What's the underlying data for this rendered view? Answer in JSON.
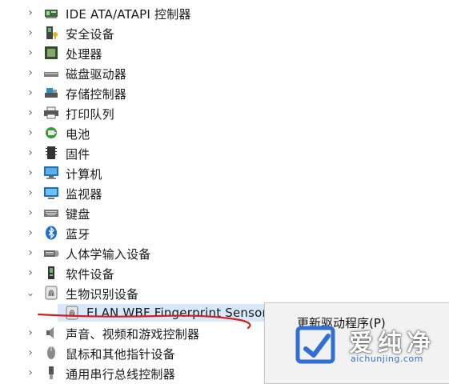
{
  "tree": {
    "items": [
      {
        "label": "IDE ATA/ATAPI 控制器",
        "icon": "ide-controller-icon",
        "expanded": false
      },
      {
        "label": "安全设备",
        "icon": "security-device-icon",
        "expanded": false
      },
      {
        "label": "处理器",
        "icon": "processor-icon",
        "expanded": false
      },
      {
        "label": "磁盘驱动器",
        "icon": "disk-drive-icon",
        "expanded": false
      },
      {
        "label": "存储控制器",
        "icon": "storage-controller-icon",
        "expanded": false
      },
      {
        "label": "打印队列",
        "icon": "printer-icon",
        "expanded": false
      },
      {
        "label": "电池",
        "icon": "battery-icon",
        "expanded": false
      },
      {
        "label": "固件",
        "icon": "firmware-icon",
        "expanded": false
      },
      {
        "label": "计算机",
        "icon": "computer-icon",
        "expanded": false
      },
      {
        "label": "监视器",
        "icon": "monitor-icon",
        "expanded": false
      },
      {
        "label": "键盘",
        "icon": "keyboard-icon",
        "expanded": false
      },
      {
        "label": "蓝牙",
        "icon": "bluetooth-icon",
        "expanded": false
      },
      {
        "label": "人体学输入设备",
        "icon": "hid-icon",
        "expanded": false
      },
      {
        "label": "软件设备",
        "icon": "software-device-icon",
        "expanded": false
      },
      {
        "label": "生物识别设备",
        "icon": "fingerprint-icon",
        "expanded": true
      },
      {
        "label": "ELAN WBF Fingerprint Sensor",
        "icon": "fingerprint-icon",
        "child": true,
        "selected": true
      },
      {
        "label": "声音、视频和游戏控制器",
        "icon": "speaker-icon",
        "expanded": false
      },
      {
        "label": "鼠标和其他指针设备",
        "icon": "mouse-icon",
        "expanded": false
      },
      {
        "label": "通用串行总线控制器",
        "icon": "usb-icon",
        "expanded": false
      }
    ]
  },
  "context_menu": {
    "first_item": "更新驱动程序(P)"
  },
  "watermark": {
    "brand": "爱纯净",
    "url": "aichunjing.com"
  },
  "colors": {
    "selected_bg": "#d7e8fa",
    "annotation_red": "#d42020",
    "watermark_blue": "#2f6fd6"
  }
}
